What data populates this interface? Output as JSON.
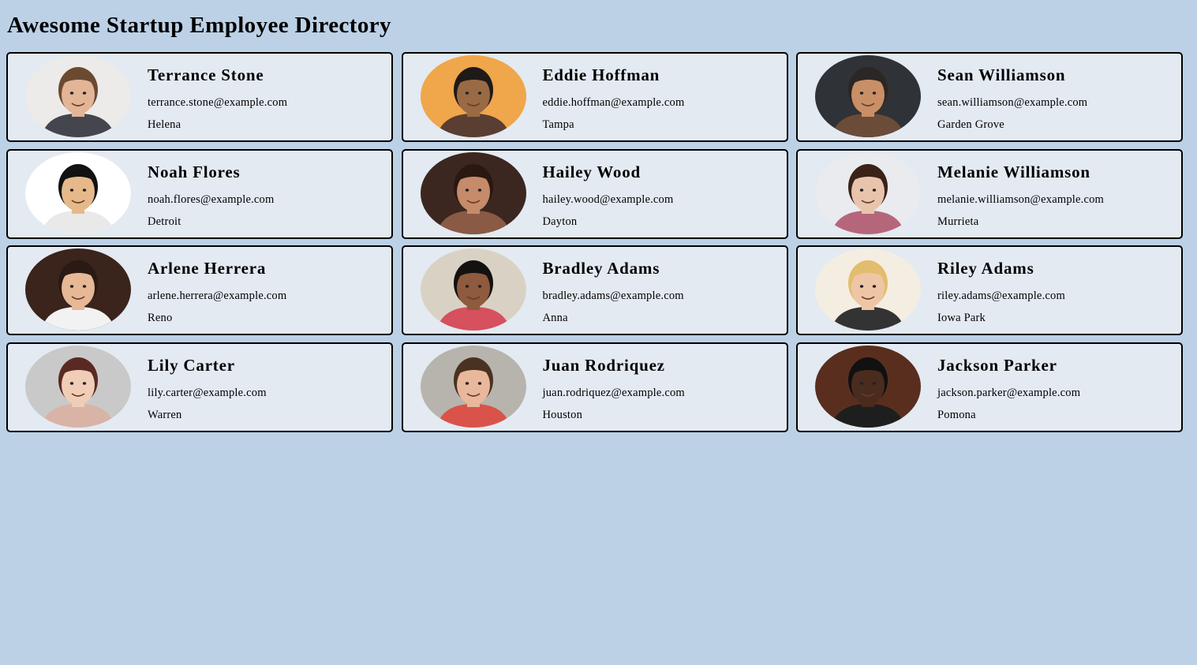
{
  "header": {
    "title": "Awesome Startup Employee Directory"
  },
  "employees": [
    {
      "name": "Terrance Stone",
      "email": "terrance.stone@example.com",
      "city": "Helena",
      "photo": {
        "bg": "#ecebe9",
        "skin": "#e3b597",
        "hair": "#6b4a32",
        "shirt": "#45454d"
      }
    },
    {
      "name": "Eddie Hoffman",
      "email": "eddie.hoffman@example.com",
      "city": "Tampa",
      "photo": {
        "bg": "#f0a64a",
        "skin": "#9a6a45",
        "hair": "#1f1a18",
        "shirt": "#5a3e32"
      }
    },
    {
      "name": "Sean Williamson",
      "email": "sean.williamson@example.com",
      "city": "Garden Grove",
      "photo": {
        "bg": "#2f3236",
        "skin": "#c98f66",
        "hair": "#2b2725",
        "shirt": "#6b4c38"
      }
    },
    {
      "name": "Noah Flores",
      "email": "noah.flores@example.com",
      "city": "Detroit",
      "photo": {
        "bg": "#ffffff",
        "skin": "#e6b98a",
        "hair": "#121212",
        "shirt": "#e9e9e9"
      }
    },
    {
      "name": "Hailey Wood",
      "email": "hailey.wood@example.com",
      "city": "Dayton",
      "photo": {
        "bg": "#3b2720",
        "skin": "#c58b6a",
        "hair": "#2a1812",
        "shirt": "#8a5a45"
      }
    },
    {
      "name": "Melanie Williamson",
      "email": "melanie.williamson@example.com",
      "city": "Murrieta",
      "photo": {
        "bg": "#e9ebef",
        "skin": "#e8c4ac",
        "hair": "#3a2218",
        "shirt": "#b6667a"
      }
    },
    {
      "name": "Arlene Herrera",
      "email": "arlene.herrera@example.com",
      "city": "Reno",
      "photo": {
        "bg": "#3a241c",
        "skin": "#e6b896",
        "hair": "#2a1a14",
        "shirt": "#f2f2f2"
      }
    },
    {
      "name": "Bradley Adams",
      "email": "bradley.adams@example.com",
      "city": "Anna",
      "photo": {
        "bg": "#d9d2c4",
        "skin": "#8f5a3d",
        "hair": "#141210",
        "shirt": "#d6505e"
      }
    },
    {
      "name": "Riley Adams",
      "email": "riley.adams@example.com",
      "city": "Iowa Park",
      "photo": {
        "bg": "#f4eee2",
        "skin": "#eec6a6",
        "hair": "#e3bd6e",
        "shirt": "#333333"
      }
    },
    {
      "name": "Lily Carter",
      "email": "lily.carter@example.com",
      "city": "Warren",
      "photo": {
        "bg": "#c9c9c9",
        "skin": "#f0cdb6",
        "hair": "#5a2a22",
        "shirt": "#d8b3a6"
      }
    },
    {
      "name": "Juan Rodriquez",
      "email": "juan.rodriquez@example.com",
      "city": "Houston",
      "photo": {
        "bg": "#b7b4ae",
        "skin": "#e9b79b",
        "hair": "#4a3222",
        "shirt": "#d9534a"
      }
    },
    {
      "name": "Jackson Parker",
      "email": "jackson.parker@example.com",
      "city": "Pomona",
      "photo": {
        "bg": "#5a2e1e",
        "skin": "#4a2c1e",
        "hair": "#111111",
        "shirt": "#1e1e1e"
      }
    }
  ]
}
